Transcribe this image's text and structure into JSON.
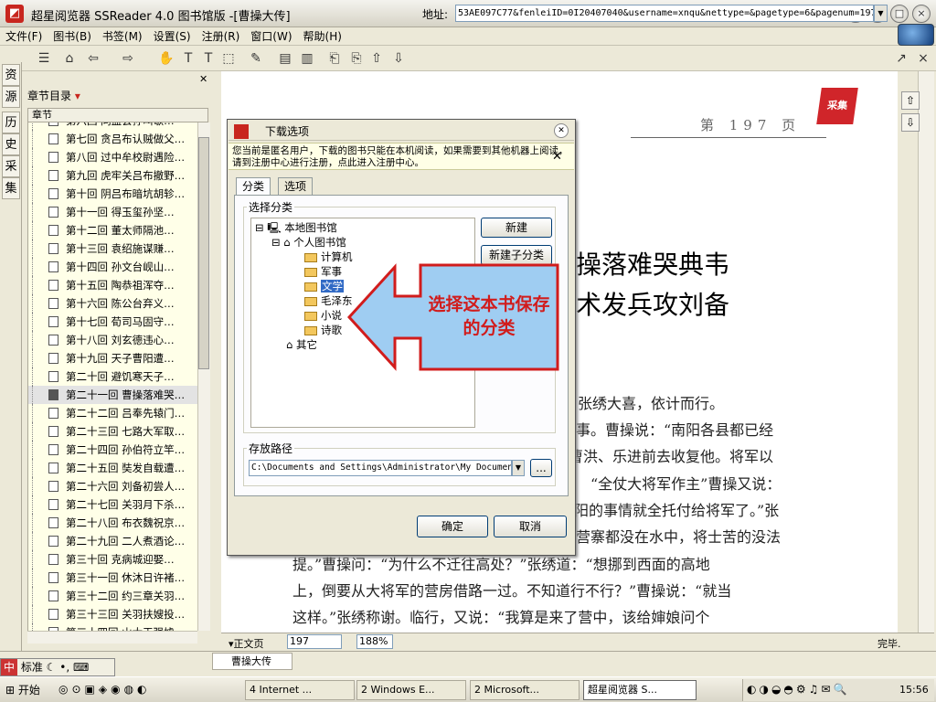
{
  "window": {
    "title": "超星阅览器 SSReader 4.0 图书馆版 -[曹操大传]"
  },
  "menu": [
    "文件(F)",
    "图书(B)",
    "书签(M)",
    "设置(S)",
    "注册(R)",
    "窗口(W)",
    "帮助(H)"
  ],
  "toolbar": {
    "address_label": "地址:",
    "address_value": "53AE097C77&fenleiID=0I20407040&username=xnqu&nettype=&pagetype=6&pagenum=197"
  },
  "side_tabs": [
    "资",
    "源",
    "历",
    "史",
    "采",
    "集"
  ],
  "sidebar": {
    "title": "章节目录",
    "column": "章节",
    "chapters": [
      "第六回 同盟会孙叫歇…",
      "第七回 贪吕布认贼做父…",
      "第八回 过中牟校尉遇险…",
      "第九回 虎牢关吕布撤野…",
      "第十回 阴吕布暗坑胡轸…",
      "第十一回 得玉玺孙坚…",
      "第十二回 董太师隔池…",
      "第十三回 袁绍施谋赚…",
      "第十四回 孙文台岘山…",
      "第十五回 陶恭祖浑夺…",
      "第十六回 陈公台弃义…",
      "第十七回 荀司马固守…",
      "第十八回 刘玄德违心…",
      "第十九回 天子曹阳遭…",
      "第二十回 避饥寒天子…",
      "第二十一回 曹操落难哭…",
      "第二十二回 吕奉先辕门…",
      "第二十三回 七路大军取…",
      "第二十四回 孙伯符立竿…",
      "第二十五回 奘发自载遭…",
      "第二十六回 刘备初尝人…",
      "第二十七回 关羽月下杀…",
      "第二十八回 布衣魏祝京…",
      "第二十九回 二人煮酒论…",
      "第三十回 克病城迎娶…",
      "第三十一回 休沐日许褚…",
      "第三十二回 约三章关羽…",
      "第三十三回 关羽扶嫂投…",
      "第三十四回 山大王强掳…",
      "第三十五回 设奇谋乌巢…",
      "第三十六回 暴降轻佻遭…",
      "第三十七回 刘备做王产…"
    ],
    "selected_index": 15
  },
  "book": {
    "page_label": "第 197 页",
    "chapter_lines": [
      "操落难哭典韦",
      "术发兵攻刘备"
    ],
    "paragraphs": [
      "。张绣大喜，依计而行。",
      "事。曹操说：“南阳各县都已经",
      "曹洪、乐进前去收复他。将军以",
      "“全仗大将军作主”曹操又说：",
      "阳的事情就全托付给将军了。”张",
      "营寨都没在水中，将士苦的没法",
      "提。”曹操问：“为什么不迁往高处？”张绣道：“想挪到西面的高地",
      "上，倒要从大将军的营房借路一过。不知道行不行？”曹操说：“就当",
      "这样。”张绣称谢。临行，又说：“我算是来了营中，该给婶娘问个"
    ],
    "logo": "采集"
  },
  "statusbar": {
    "view": "正文页",
    "page": "197",
    "zoom": "188%",
    "status": "完毕."
  },
  "book_tab": "曹操大传",
  "ime": "标准",
  "taskbar": {
    "start": "开始",
    "tasks": [
      "4 Internet ...",
      "2 Windows E...",
      "2 Microsoft...",
      "超星阅览器 S..."
    ],
    "clock": "15:56"
  },
  "dialog": {
    "title": "下载选项",
    "notice": "您当前是匿名用户，下载的图书只能在本机阅读，如果需要到其他机器上阅读，请到注册中心进行注册，点此进入注册中心。",
    "tabs": [
      "分类",
      "选项"
    ],
    "group_category": "选择分类",
    "tree": {
      "root": "本地图书馆",
      "personal": "个人图书馆",
      "folders": [
        "计算机",
        "军事",
        "文学",
        "毛泽东",
        "小说",
        "诗歌"
      ],
      "other": "其它",
      "selected": "文学"
    },
    "btn_new": "新建",
    "btn_new_sub": "新建子分类",
    "group_path": "存放路径",
    "path": "C:\\Documents and Settings\\Administrator\\My Documents",
    "btn_browse": "...",
    "btn_ok": "确定",
    "btn_cancel": "取消"
  },
  "callout": "选择这本书保存的分类",
  "colors": {
    "callout_red": "#d11c1c",
    "callout_fill": "#9fcdf2",
    "brand_red": "#c8261e"
  }
}
